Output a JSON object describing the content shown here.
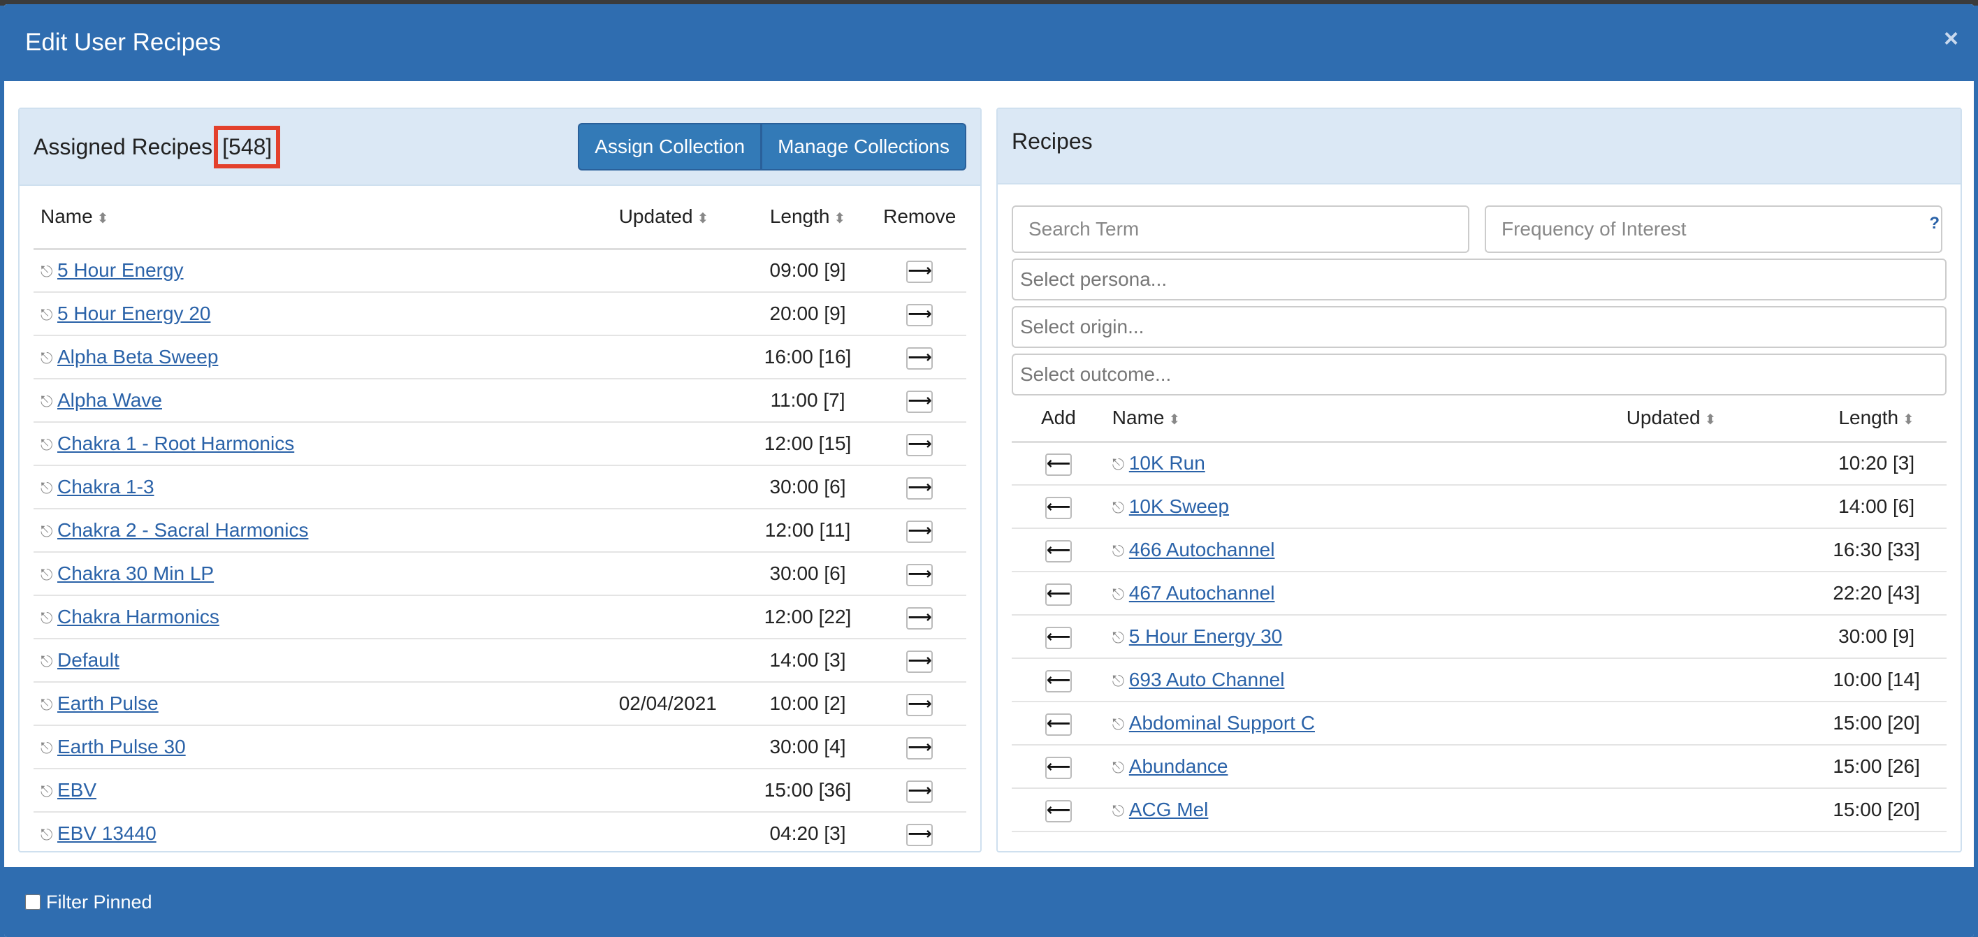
{
  "modal": {
    "title": "Edit User Recipes",
    "close": "×"
  },
  "assigned": {
    "title": "Assigned Recipes",
    "count": "[548]",
    "assign_collection": "Assign Collection",
    "manage_collections": "Manage Collections",
    "columns": {
      "name": "Name",
      "updated": "Updated",
      "length": "Length",
      "remove": "Remove"
    },
    "rows": [
      {
        "name": "5 Hour Energy",
        "updated": "",
        "length": "09:00 [9]"
      },
      {
        "name": "5 Hour Energy 20",
        "updated": "",
        "length": "20:00 [9]"
      },
      {
        "name": "Alpha Beta Sweep",
        "updated": "",
        "length": "16:00 [16]"
      },
      {
        "name": "Alpha Wave",
        "updated": "",
        "length": "11:00 [7]"
      },
      {
        "name": "Chakra 1 - Root Harmonics",
        "updated": "",
        "length": "12:00 [15]"
      },
      {
        "name": "Chakra 1-3",
        "updated": "",
        "length": "30:00 [6]"
      },
      {
        "name": "Chakra 2 - Sacral Harmonics",
        "updated": "",
        "length": "12:00 [11]"
      },
      {
        "name": "Chakra 30 Min LP",
        "updated": "",
        "length": "30:00 [6]"
      },
      {
        "name": "Chakra Harmonics",
        "updated": "",
        "length": "12:00 [22]"
      },
      {
        "name": "Default",
        "updated": "",
        "length": "14:00 [3]"
      },
      {
        "name": "Earth Pulse",
        "updated": "02/04/2021",
        "length": "10:00 [2]"
      },
      {
        "name": "Earth Pulse 30",
        "updated": "",
        "length": "30:00 [4]"
      },
      {
        "name": "EBV",
        "updated": "",
        "length": "15:00 [36]"
      },
      {
        "name": "EBV 13440",
        "updated": "",
        "length": "04:20 [3]"
      }
    ]
  },
  "recipes": {
    "title": "Recipes",
    "search_placeholder": "Search Term",
    "frequency_placeholder": "Frequency of Interest",
    "help": "?",
    "persona_placeholder": "Select persona...",
    "origin_placeholder": "Select origin...",
    "outcome_placeholder": "Select outcome...",
    "columns": {
      "add": "Add",
      "name": "Name",
      "updated": "Updated",
      "length": "Length"
    },
    "rows": [
      {
        "name": "10K Run",
        "updated": "",
        "length": "10:20 [3]"
      },
      {
        "name": "10K Sweep",
        "updated": "",
        "length": "14:00 [6]"
      },
      {
        "name": "466 Autochannel",
        "updated": "",
        "length": "16:30 [33]"
      },
      {
        "name": "467 Autochannel",
        "updated": "",
        "length": "22:20 [43]"
      },
      {
        "name": "5 Hour Energy 30",
        "updated": "",
        "length": "30:00 [9]"
      },
      {
        "name": "693 Auto Channel",
        "updated": "",
        "length": "10:00 [14]"
      },
      {
        "name": "Abdominal Support C",
        "updated": "",
        "length": "15:00 [20]"
      },
      {
        "name": "Abundance",
        "updated": "",
        "length": "15:00 [26]"
      },
      {
        "name": "ACG Mel",
        "updated": "",
        "length": "15:00 [20]"
      }
    ]
  },
  "footer": {
    "filter_pinned": "Filter Pinned"
  },
  "icons": {
    "pin": "pin-icon",
    "remove_arrow": "arrow-right-icon",
    "add_arrow": "arrow-left-icon",
    "sort": "sort-icon"
  }
}
